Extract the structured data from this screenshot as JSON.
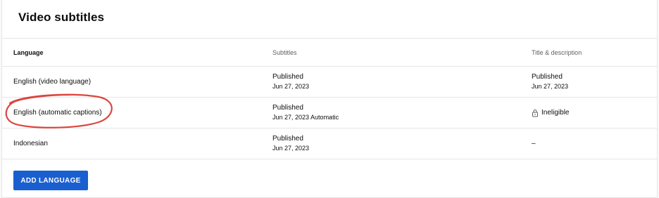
{
  "page": {
    "title": "Video subtitles"
  },
  "table": {
    "headers": {
      "language": "Language",
      "subtitles": "Subtitles",
      "title_description": "Title & description"
    },
    "rows": [
      {
        "language": "English (video language)",
        "subtitles": {
          "status": "Published",
          "date": "Jun 27, 2023"
        },
        "title_description": {
          "status": "Published",
          "date": "Jun 27, 2023"
        }
      },
      {
        "language": "English (automatic captions)",
        "subtitles": {
          "status": "Published",
          "date": "Jun 27, 2023 Automatic"
        },
        "title_description": {
          "status": "Ineligible",
          "icon": "lock-icon"
        }
      },
      {
        "language": "Indonesian",
        "subtitles": {
          "status": "Published",
          "date": "Jun 27, 2023"
        },
        "title_description": {
          "status": "–"
        }
      }
    ]
  },
  "actions": {
    "add_language": "ADD LANGUAGE"
  },
  "colors": {
    "accent": "#1a5fcf",
    "annotation": "#d7322a",
    "divider": "#e5e5e5"
  }
}
